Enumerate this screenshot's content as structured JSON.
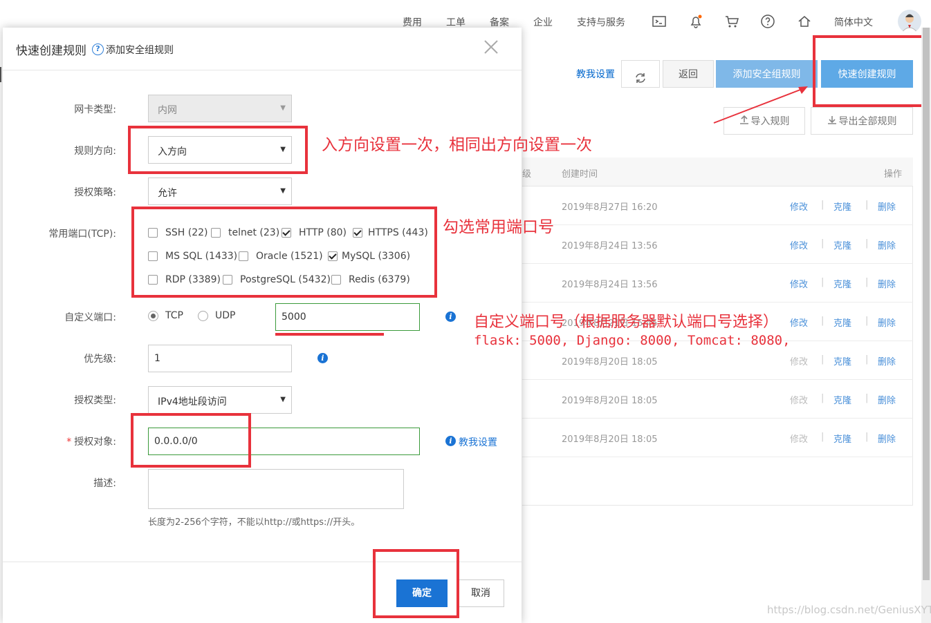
{
  "topnav": {
    "items": [
      "费用",
      "工单",
      "备案",
      "企业",
      "支持与服务"
    ],
    "language": "简体中文",
    "icons": [
      "terminal-icon",
      "bell-icon",
      "cart-icon",
      "help-circle-icon",
      "home-icon"
    ]
  },
  "toolbar": {
    "teach_link": "教我设置",
    "back": "返回",
    "add_rule": "添加安全组规则",
    "quick_create": "快速创建规则",
    "import": "导入规则",
    "export": "导出全部规则"
  },
  "table": {
    "col_partial": "级",
    "col_time": "创建时间",
    "col_ops": "操作",
    "rows": [
      {
        "time": "2019年8月27日 16:20",
        "edit_enabled": true
      },
      {
        "time": "2019年8月24日 13:56",
        "edit_enabled": true
      },
      {
        "time": "2019年8月24日 13:56",
        "edit_enabled": true
      },
      {
        "time": "2019年8月21日 15:45",
        "edit_enabled": true
      },
      {
        "time": "2019年8月20日 18:05",
        "edit_enabled": false
      },
      {
        "time": "2019年8月20日 18:05",
        "edit_enabled": false
      },
      {
        "time": "2019年8月20日 18:05",
        "edit_enabled": false
      }
    ],
    "op_edit": "修改",
    "op_clone": "克隆",
    "op_delete": "删除",
    "sep": "|"
  },
  "modal": {
    "title": "快速创建规则",
    "subtitle": "添加安全组规则",
    "nic_label": "网卡类型:",
    "nic_value": "内网",
    "direction_label": "规则方向:",
    "direction_value": "入方向",
    "policy_label": "授权策略:",
    "policy_value": "允许",
    "ports_label": "常用端口(TCP):",
    "ports": [
      {
        "label": "SSH (22)",
        "checked": false
      },
      {
        "label": "telnet (23)",
        "checked": false
      },
      {
        "label": "HTTP (80)",
        "checked": true
      },
      {
        "label": "HTTPS (443)",
        "checked": true
      },
      {
        "label": "MS SQL (1433)",
        "checked": false
      },
      {
        "label": "Oracle (1521)",
        "checked": false
      },
      {
        "label": "MySQL (3306)",
        "checked": true
      },
      {
        "label": "RDP (3389)",
        "checked": false
      },
      {
        "label": "PostgreSQL (5432)",
        "checked": false
      },
      {
        "label": "Redis (6379)",
        "checked": false
      }
    ],
    "custom_port_label": "自定义端口:",
    "proto_tcp": "TCP",
    "proto_udp": "UDP",
    "custom_port_value": "5000",
    "priority_label": "优先级:",
    "priority_value": "1",
    "auth_type_label": "授权类型:",
    "auth_type_value": "IPv4地址段访问",
    "auth_object_label": "授权对象:",
    "required_mark": "*",
    "auth_object_value": "0.0.0.0/0",
    "teach_link": "教我设置",
    "desc_label": "描述:",
    "desc_hint": "长度为2-256个字符，不能以http://或https://开头。",
    "ok": "确定",
    "cancel": "取消"
  },
  "annotations": {
    "direction_note": "入方向设置一次，相同出方向设置一次",
    "ports_note": "勾选常用端口号",
    "custom_note_line1": "自定义端口号（根据服务器默认端口号选择）",
    "custom_note_line2": "flask: 5000, Django: 8000, Tomcat: 8080,",
    "color": "#e8323c"
  },
  "watermark": "https://blog.csdn.net/GeniusXYT"
}
